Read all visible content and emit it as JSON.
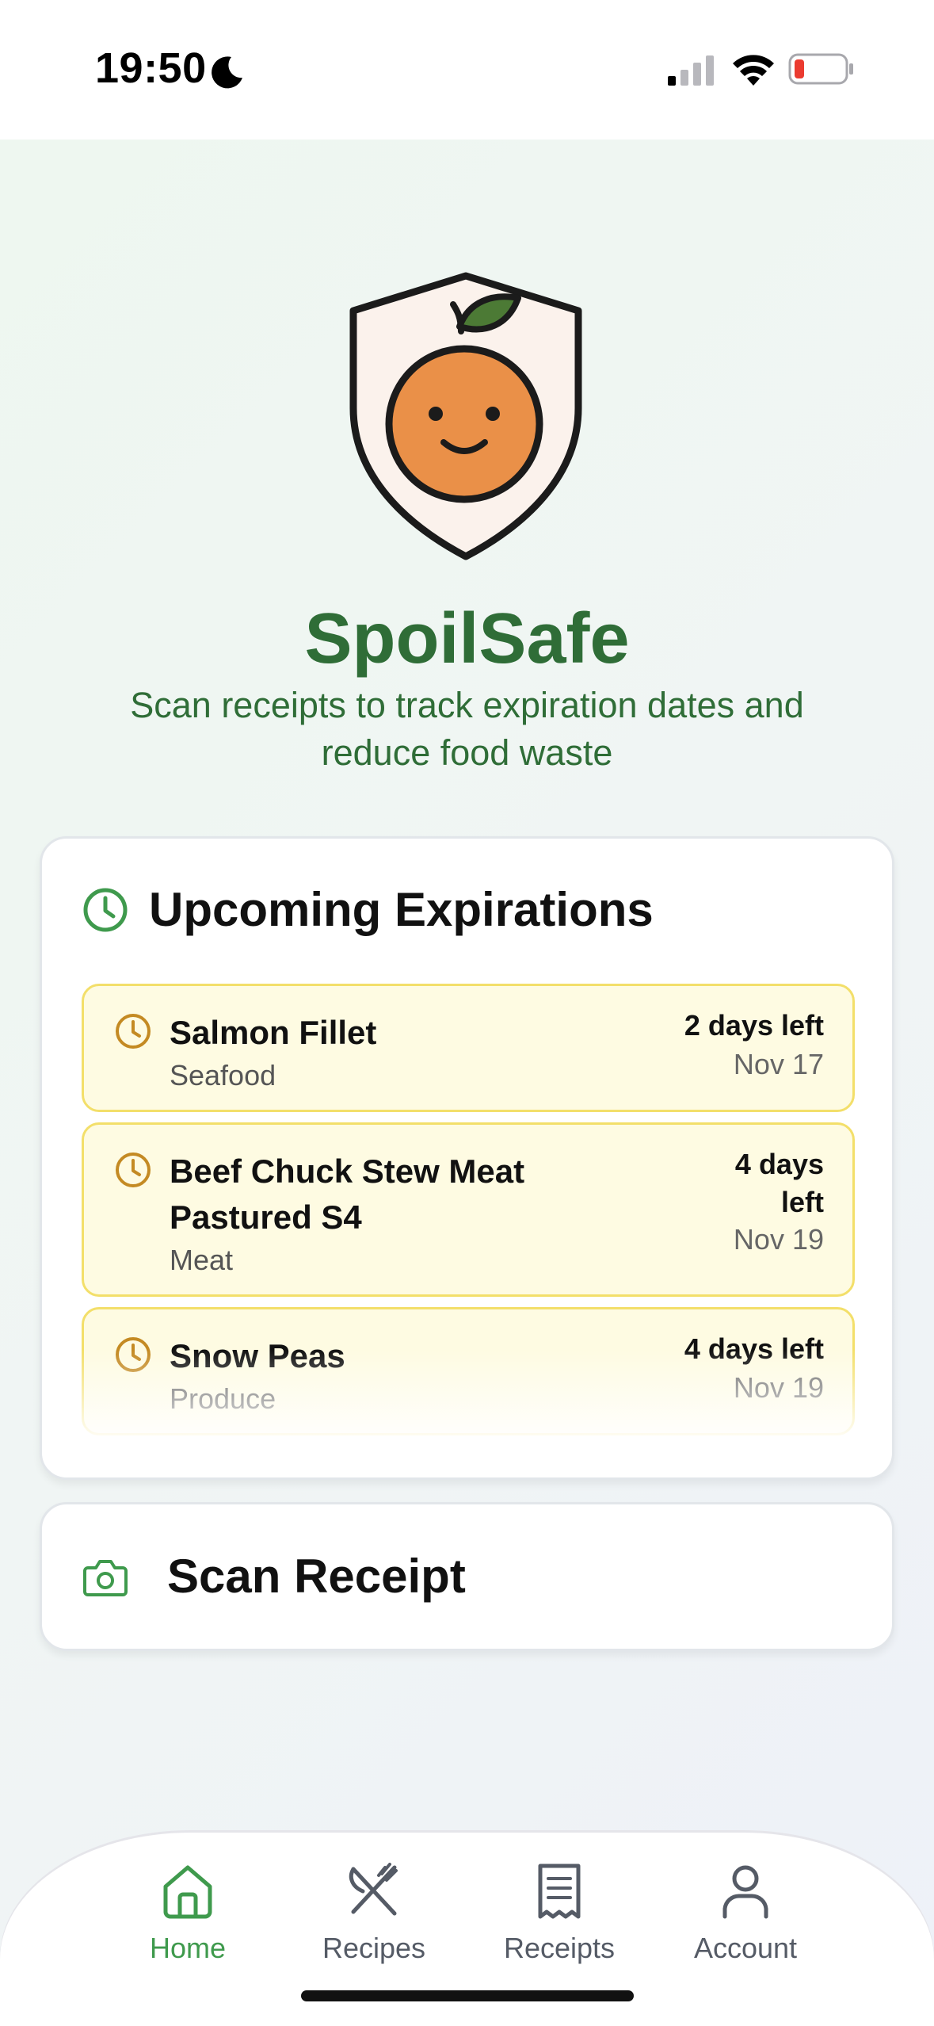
{
  "status_bar": {
    "time": "19:50"
  },
  "app": {
    "title": "SpoilSafe",
    "subtitle": "Scan receipts to track expiration dates and reduce food waste"
  },
  "expirations": {
    "title": "Upcoming Expirations",
    "items": [
      {
        "name": "Salmon Fillet",
        "category": "Seafood",
        "days_left": "2 days left",
        "date": "Nov 17"
      },
      {
        "name": "Beef Chuck Stew Meat Pastured S4",
        "category": "Meat",
        "days_left": "4 days left",
        "date": "Nov 19"
      },
      {
        "name": "Snow Peas",
        "category": "Produce",
        "days_left": "4 days left",
        "date": "Nov 19"
      }
    ]
  },
  "scan": {
    "label": "Scan Receipt"
  },
  "tabs": [
    {
      "label": "Home",
      "icon": "home-icon",
      "active": true
    },
    {
      "label": "Recipes",
      "icon": "fork-knife-icon",
      "active": false
    },
    {
      "label": "Receipts",
      "icon": "receipt-icon",
      "active": false
    },
    {
      "label": "Account",
      "icon": "user-icon",
      "active": false
    }
  ],
  "colors": {
    "brand_green": "#2f6d37",
    "accent_green": "#3f9a4d",
    "warning_bg": "#fefbe2",
    "warning_border": "#f3df6a",
    "warning_icon": "#c48a23"
  }
}
